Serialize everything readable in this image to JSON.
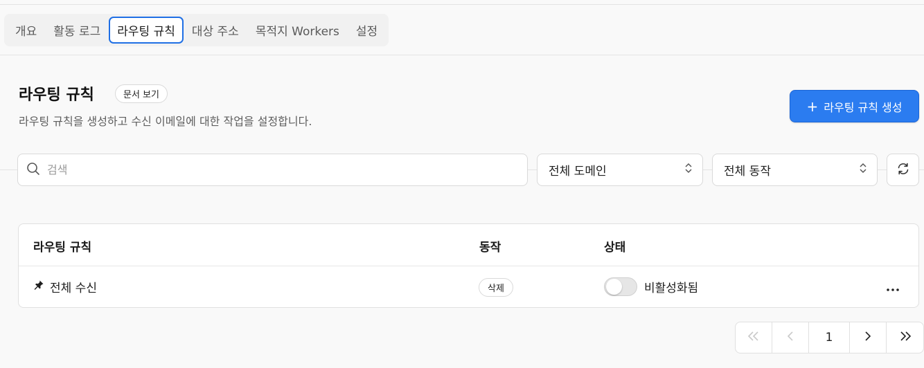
{
  "tabs": [
    {
      "label": "개요",
      "active": false
    },
    {
      "label": "활동 로그",
      "active": false
    },
    {
      "label": "라우팅 규칙",
      "active": true
    },
    {
      "label": "대상 주소",
      "active": false
    },
    {
      "label": "목적지 Workers",
      "active": false
    },
    {
      "label": "설정",
      "active": false
    }
  ],
  "header": {
    "title": "라우팅 규칙",
    "docs_label": "문서 보기",
    "subtitle": "라우팅 규칙을 생성하고 수신 이메일에 대한 작업을 설정합니다.",
    "create_label": "라우팅 규칙 생성",
    "create_icon": "plus-icon"
  },
  "filters": {
    "search_placeholder": "검색",
    "domain_select": "전체 도메인",
    "action_select": "전체 동작",
    "refresh_icon": "refresh-icon"
  },
  "table": {
    "columns": [
      "라우팅 규칙",
      "동작",
      "상태"
    ],
    "rows": [
      {
        "rule": "전체 수신",
        "rule_icon": "pin-icon",
        "action": "삭제",
        "status": "비활성화됨",
        "enabled": false
      }
    ]
  },
  "pagination": {
    "current_page": "1",
    "first_disabled": true,
    "prev_disabled": true
  },
  "colors": {
    "accent": "#2b7cf0",
    "active_tab_border": "#1f6fe5"
  }
}
